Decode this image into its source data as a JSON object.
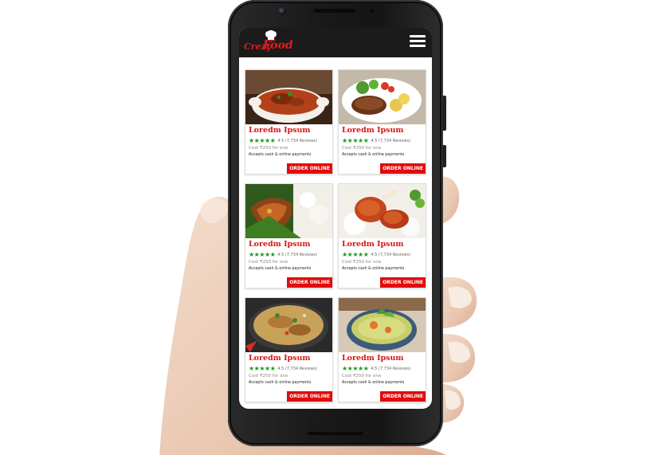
{
  "app": {
    "logo_part1": "Crezy",
    "logo_part2": "Food",
    "menu_icon": "hamburger-menu-icon"
  },
  "colors": {
    "brand_red": "#e10c0c",
    "header_bg": "#1b1b1b",
    "star_green": "#1c9a1c"
  },
  "restaurants": [
    {
      "name": "Loredm Ipsum",
      "stars": "★★★★★",
      "rating": "4.5 (7,734 Reviews)",
      "cost": "Cost ₹250 for one",
      "payment": "Accepts cash & online payments",
      "button": "ORDER ONLINE",
      "image": "curry-bowl"
    },
    {
      "name": "Loredm Ipsum",
      "stars": "★★★★★",
      "rating": "4.5 (7,734 Reviews)",
      "cost": "Cost ₹250 for one",
      "payment": "Accepts cash & online payments",
      "button": "ORDER ONLINE",
      "image": "steak-plate"
    },
    {
      "name": "Loredm Ipsum",
      "stars": "★★★★★",
      "rating": "4.5 (7,734 Reviews)",
      "cost": "Cost ₹250 for one",
      "payment": "Accepts cash & online payments",
      "button": "ORDER ONLINE",
      "image": "fish-rice"
    },
    {
      "name": "Loredm Ipsum",
      "stars": "★★★★★",
      "rating": "4.5 (7,734 Reviews)",
      "cost": "Cost ₹250 for one",
      "payment": "Accepts cash & online payments",
      "button": "ORDER ONLINE",
      "image": "chicken-legs"
    },
    {
      "name": "Loredm Ipsum",
      "stars": "★★★★★",
      "rating": "4.5 (7,734 Reviews)",
      "cost": "Cost ₹250 for one",
      "payment": "Accepts cash & online payments",
      "button": "ORDER ONLINE",
      "image": "biryani-pan"
    },
    {
      "name": "Loredm Ipsum",
      "stars": "★★★★★",
      "rating": "4.5 (7,734 Reviews)",
      "cost": "Cost ₹250 for one",
      "payment": "Accepts cash & online payments",
      "button": "ORDER ONLINE",
      "image": "green-curry"
    }
  ]
}
